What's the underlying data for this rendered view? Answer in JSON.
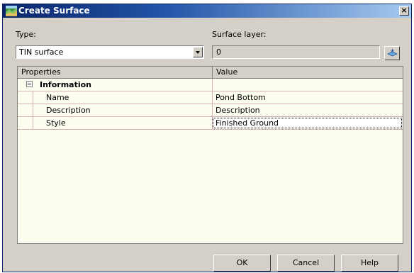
{
  "window": {
    "title": "Create Surface",
    "close_glyph": "×",
    "icon": "surface-app-icon"
  },
  "type": {
    "label": "Type:",
    "selected": "TIN surface"
  },
  "surface_layer": {
    "label": "Surface layer:",
    "value": "0",
    "pick_icon": "layer-pick-icon"
  },
  "grid": {
    "columns": [
      "Properties",
      "Value"
    ],
    "category": "Information",
    "rows": [
      {
        "name": "Name",
        "value": "Pond Bottom"
      },
      {
        "name": "Description",
        "value": "Description"
      },
      {
        "name": "Style",
        "value": "Finished Ground"
      }
    ]
  },
  "buttons": {
    "ok": "OK",
    "cancel": "Cancel",
    "help": "Help"
  },
  "colors": {
    "title_bar_start": "#0a246a",
    "dialog_face": "#d4d0c8",
    "grid_background": "#fdfdf0",
    "row_line": "#d9b0b6"
  }
}
